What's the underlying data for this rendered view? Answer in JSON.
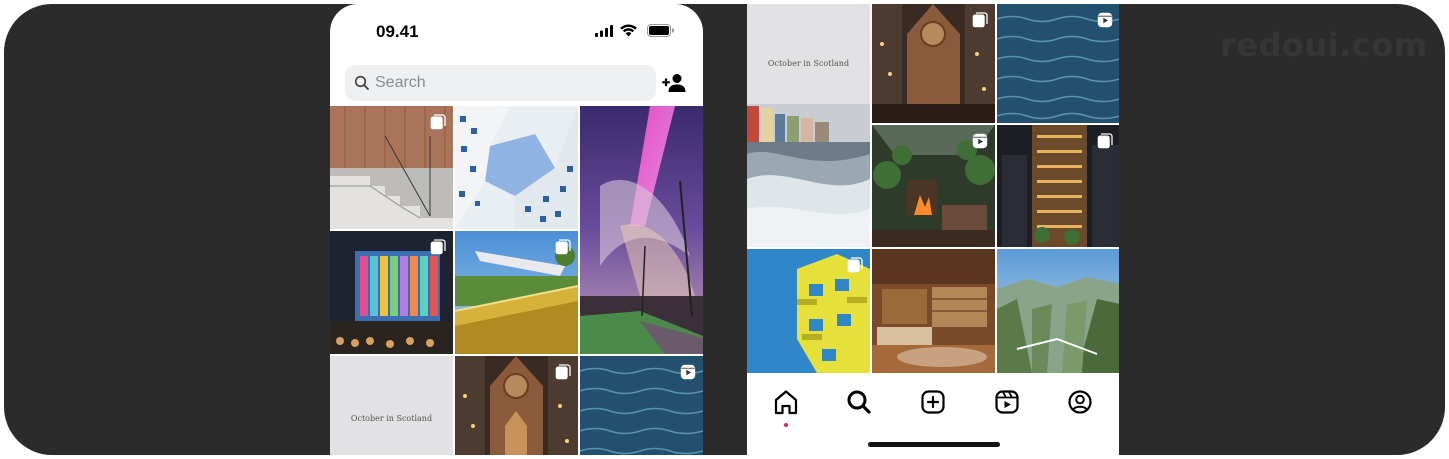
{
  "watermark": "redoui.com",
  "left_phone": {
    "status_bar": {
      "time": "09.41",
      "icons": [
        "cellular-signal-icon",
        "wifi-icon",
        "battery-icon"
      ]
    },
    "search": {
      "placeholder": "Search"
    },
    "add_user_icon": "add-user-icon",
    "grid": [
      {
        "subject": "stone steps interior",
        "badge": "carousel"
      },
      {
        "subject": "building facade looking up",
        "badge": "none"
      },
      {
        "subject": "aurora sky street",
        "badge": "none"
      },
      {
        "subject": "colorful building at night",
        "badge": "carousel"
      },
      {
        "subject": "yellow walkway park",
        "badge": "carousel"
      },
      {
        "subject": "October in Scotland poster",
        "badge": "none",
        "caption": "October in Scotland"
      },
      {
        "subject": "gothic cathedral street",
        "badge": "carousel"
      },
      {
        "subject": "ocean water",
        "badge": "reel"
      }
    ]
  },
  "right_phone": {
    "grid": [
      {
        "subject": "October in Scotland",
        "badge": "none",
        "caption": "October in Scotland"
      },
      {
        "subject": "gothic cathedral street",
        "badge": "carousel"
      },
      {
        "subject": "ocean water",
        "badge": "reel"
      },
      {
        "subject": "jungle cabin fireplace",
        "badge": "reel"
      },
      {
        "subject": "skyscraper night",
        "badge": "carousel"
      },
      {
        "subject": "yellow balconies",
        "badge": "carousel"
      },
      {
        "subject": "retro living room",
        "badge": "none"
      },
      {
        "subject": "canyon bridge",
        "badge": "none"
      }
    ],
    "tabbar": {
      "tabs": [
        "home-icon",
        "search-icon",
        "create-icon",
        "reels-icon",
        "profile-icon"
      ],
      "active": "home-icon",
      "notification_color": "#e0245e"
    }
  }
}
